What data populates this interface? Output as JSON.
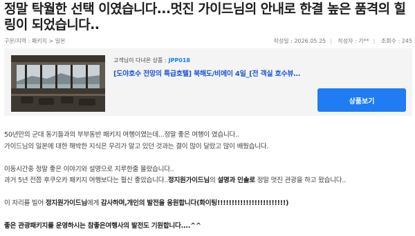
{
  "post": {
    "title": "정말 탁월한 선택 이였습니다...멋진 가이드님의 안내로 한결 높은 품격의 힐링이 되었습니다..",
    "breadcrumb": "구분/지역 : 패키지 > 일본",
    "date_label": "작성일 : 2026.05.25",
    "author_label": "작성자 : 기**",
    "views_label": "조회수 : 245"
  },
  "product": {
    "prefix": "고객님이 다녀온 상품 :",
    "code": "JPP018",
    "name": "[도야호수 전망의 특급호텔] 북해도/비에이 4일_[전 객실 호수뷰+시내 2박+게뷔페+주류 ...",
    "button_label": "상품보기"
  },
  "content": {
    "p1": "50년만의 군대 동기들과의 부부동반 패키지 여행이였는데...정말 좋은 여행이 였습니다..",
    "p2": "가이드님의 일본에 대한 해박한 지식은 우리가 알고 있던 것과는 결이 많이 달랐고 많이 배웠습니다.",
    "p3": "이동시간중 정말 좋은 이야기와 설명으로 지루한줄 몰랐습니다..",
    "p4a": "과거 5년 전쯤 후쿠오카 패키지 여행보다는 훨신 좋았습니다..",
    "p4b": "정지원가이드님",
    "p4c": "의 ",
    "p4d": "설명과 인솔로",
    "p4e": " 정말 멋진 관광을 하고 왔습니다..",
    "p5a": "이 자리를 빌어 ",
    "p5b": "정지원가이드님",
    "p5c": "에게 ",
    "p5d": "감사하며,개인의 발전을 응원합니다(화이팅!!!!!!!!!!!!!!!!!!!!!!!!)",
    "p6": "좋은 관광패키지를 운영하시는 참좋은여행사의 발전도 기원합니다....^^"
  }
}
